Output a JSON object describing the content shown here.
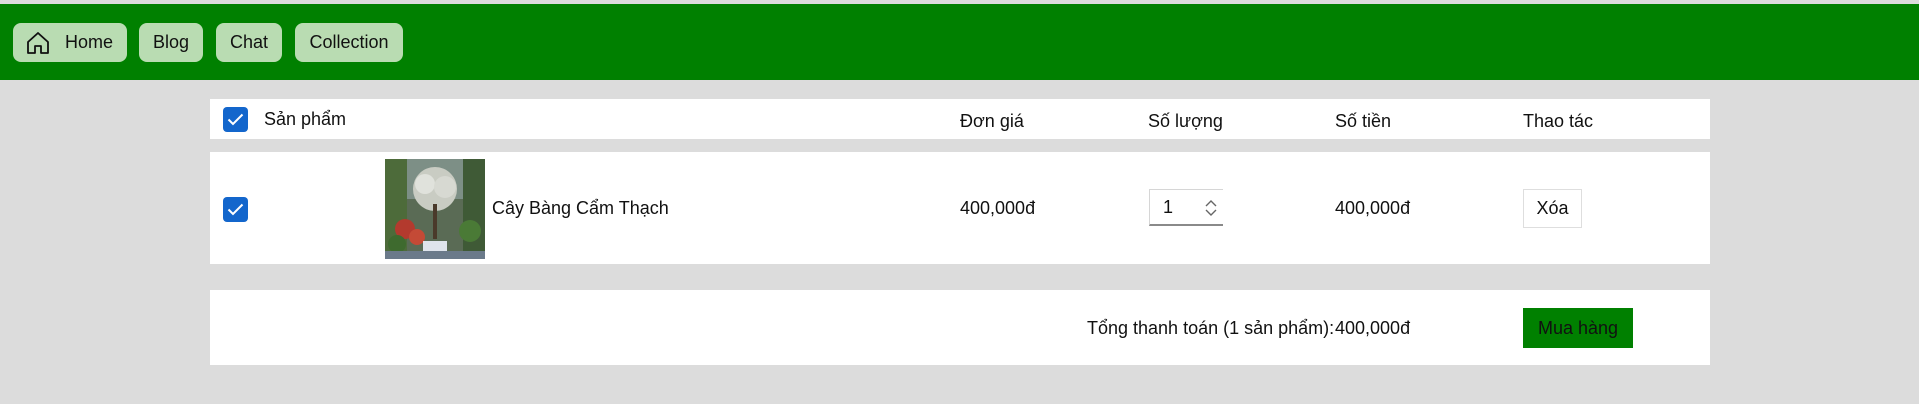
{
  "nav": {
    "home_label": "Home",
    "blog_label": "Blog",
    "chat_label": "Chat",
    "collection_label": "Collection"
  },
  "cart_header": {
    "select_all_checked": true,
    "product_col": "Sản phẩm",
    "unit_price_col": "Đơn giá",
    "quantity_col": "Số lượng",
    "amount_col": "Số tiền",
    "actions_col": "Thao tác"
  },
  "cart_items": [
    {
      "checked": true,
      "image_icon": "plant-photo",
      "name": "Cây Bàng Cẩm Thạch",
      "unit_price": "400,000đ",
      "quantity": "1",
      "amount": "400,000đ",
      "delete_label": "Xóa"
    }
  ],
  "summary": {
    "total_label": "Tổng thanh toán (1 sản phẩm):",
    "total_value": "400,000đ",
    "buy_label": "Mua hàng"
  },
  "colors": {
    "brand_green": "#008000",
    "nav_button_bg": "#b9dcb2",
    "checkbox_blue": "#1366cc",
    "page_bg": "#dcdcdc"
  }
}
